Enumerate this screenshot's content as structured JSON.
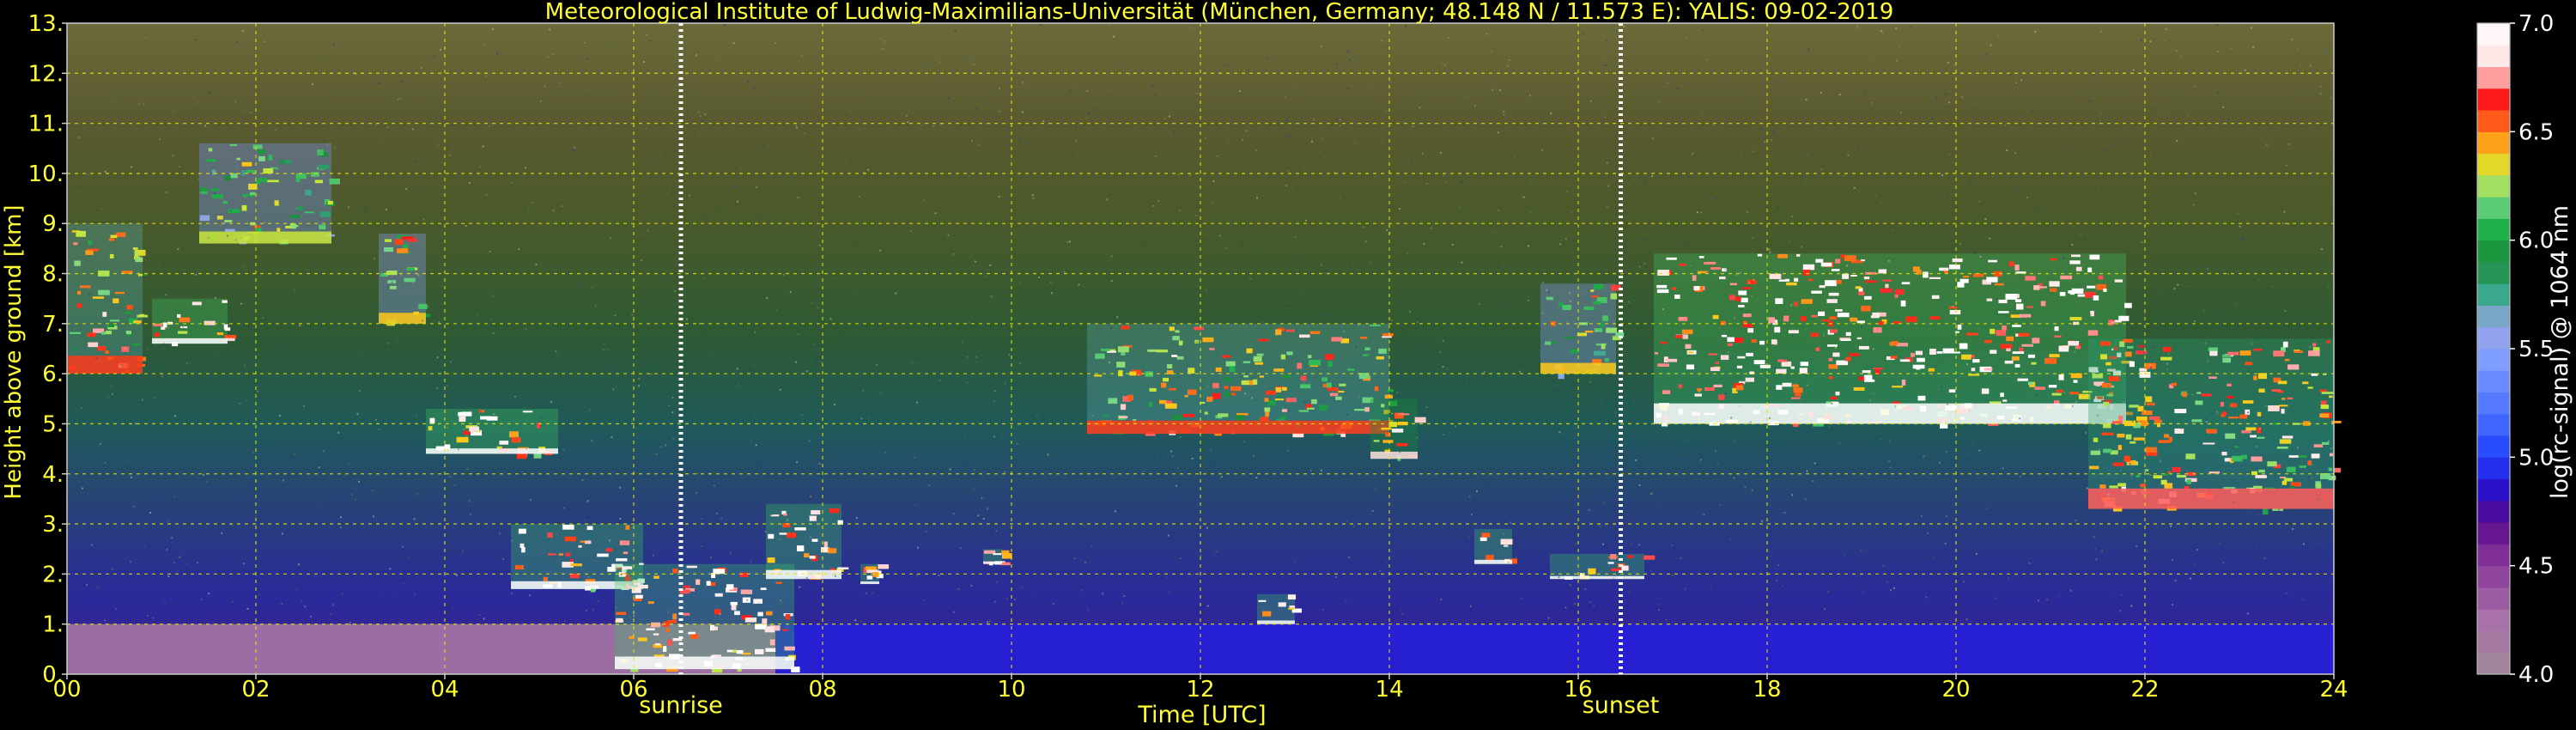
{
  "chart_data": {
    "type": "heatmap",
    "title": "Meteorological Institute of Ludwig-Maximilians-Universität (München, Germany; 48.148 N / 11.573 E):    YALIS: 09-02-2019",
    "xlabel": "Time [UTC]",
    "ylabel": "Height above ground [km]",
    "colorbar_label": "log(rc-signal) @ 1064 nm",
    "xlim": [
      0,
      24
    ],
    "ylim": [
      0,
      13
    ],
    "color_range": [
      4.0,
      7.0
    ],
    "grid": true,
    "x_ticks": [
      "00",
      "02",
      "04",
      "06",
      "08",
      "10",
      "12",
      "14",
      "16",
      "18",
      "20",
      "22",
      "24"
    ],
    "y_ticks": [
      "0.",
      "1.",
      "2.",
      "3.",
      "4.",
      "5.",
      "6.",
      "7.",
      "8.",
      "9.",
      "10.",
      "11.",
      "12.",
      "13."
    ],
    "colorbar_ticks": [
      "4.0",
      "4.5",
      "5.0",
      "5.5",
      "6.0",
      "6.5",
      "7.0"
    ],
    "markers": [
      {
        "label": "sunrise",
        "time": 6.5
      },
      {
        "label": "sunset",
        "time": 16.45
      }
    ],
    "cloud_layers": [
      {
        "t_start": 0.0,
        "t_end": 0.8,
        "base_km": 6.0,
        "top_km": 9.0,
        "peak": 6.6
      },
      {
        "t_start": 0.9,
        "t_end": 1.7,
        "base_km": 6.6,
        "top_km": 7.5,
        "peak": 7.0
      },
      {
        "t_start": 1.4,
        "t_end": 2.8,
        "base_km": 8.6,
        "top_km": 10.6,
        "peak": 6.3
      },
      {
        "t_start": 3.3,
        "t_end": 3.8,
        "base_km": 7.0,
        "top_km": 8.8,
        "peak": 6.4
      },
      {
        "t_start": 3.8,
        "t_end": 5.2,
        "base_km": 4.4,
        "top_km": 5.3,
        "peak": 7.0
      },
      {
        "t_start": 4.7,
        "t_end": 6.1,
        "base_km": 1.7,
        "top_km": 3.0,
        "peak": 7.0
      },
      {
        "t_start": 5.8,
        "t_end": 7.7,
        "base_km": 0.1,
        "top_km": 2.2,
        "peak": 7.0
      },
      {
        "t_start": 7.4,
        "t_end": 8.2,
        "base_km": 1.9,
        "top_km": 3.4,
        "peak": 7.0
      },
      {
        "t_start": 8.4,
        "t_end": 8.6,
        "base_km": 1.8,
        "top_km": 2.2,
        "peak": 7.0
      },
      {
        "t_start": 9.7,
        "t_end": 9.9,
        "base_km": 2.2,
        "top_km": 2.5,
        "peak": 7.0
      },
      {
        "t_start": 10.8,
        "t_end": 14.0,
        "base_km": 4.8,
        "top_km": 7.0,
        "peak": 6.6
      },
      {
        "t_start": 12.6,
        "t_end": 13.0,
        "base_km": 1.0,
        "top_km": 1.6,
        "peak": 7.0
      },
      {
        "t_start": 13.8,
        "t_end": 14.3,
        "base_km": 4.3,
        "top_km": 5.5,
        "peak": 6.8
      },
      {
        "t_start": 14.9,
        "t_end": 15.3,
        "base_km": 2.2,
        "top_km": 2.9,
        "peak": 7.0
      },
      {
        "t_start": 15.7,
        "t_end": 16.7,
        "base_km": 1.9,
        "top_km": 2.4,
        "peak": 7.0
      },
      {
        "t_start": 15.6,
        "t_end": 16.4,
        "base_km": 6.0,
        "top_km": 7.8,
        "peak": 6.4
      },
      {
        "t_start": 16.8,
        "t_end": 21.8,
        "base_km": 5.0,
        "top_km": 8.4,
        "peak": 7.0
      },
      {
        "t_start": 21.4,
        "t_end": 24.0,
        "base_km": 3.3,
        "top_km": 6.7,
        "peak": 6.7
      }
    ],
    "boundary_layer": [
      {
        "t_start": 0.0,
        "t_end": 7.5,
        "top_km": 1.0,
        "value": 4.2
      },
      {
        "t_start": 7.5,
        "t_end": 24.0,
        "top_km": 1.0,
        "value": 4.9
      }
    ]
  }
}
